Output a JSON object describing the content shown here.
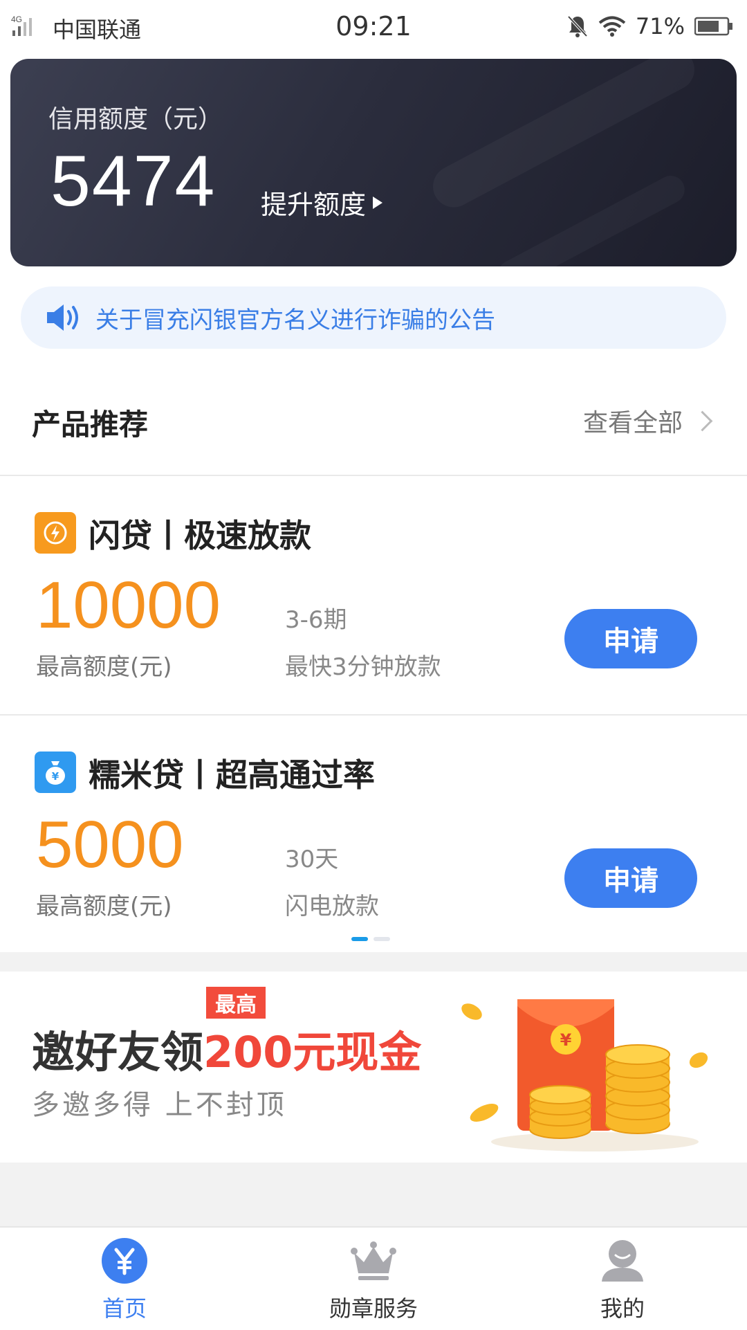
{
  "status_bar": {
    "network": "4G",
    "carrier": "中国联通",
    "time": "09:21",
    "battery": "71%"
  },
  "credit": {
    "label": "信用额度（元）",
    "amount": "5474",
    "raise_label": "提升额度"
  },
  "notice": {
    "text": "关于冒充闪银官方名义进行诈骗的公告"
  },
  "products_section": {
    "title": "产品推荐",
    "see_all": "查看全部"
  },
  "products": [
    {
      "title": "闪贷丨极速放款",
      "amount": "10000",
      "amount_label": "最高额度(元)",
      "term": "3-6期",
      "desc": "最快3分钟放款",
      "apply": "申请",
      "logo_color": "#f79a1e"
    },
    {
      "title": "糯米贷丨超高通过率",
      "amount": "5000",
      "amount_label": "最高额度(元)",
      "term": "30天",
      "desc": "闪电放款",
      "apply": "申请",
      "logo_color": "#2f9af0"
    }
  ],
  "banner": {
    "tag": "最高",
    "title_dark": "邀好友领",
    "title_red": "200元现金",
    "subtitle": "多邀多得  上不封顶"
  },
  "bottom_nav": {
    "home": "首页",
    "medal": "勋章服务",
    "mine": "我的"
  },
  "colors": {
    "accent_blue": "#3d7ff0",
    "amount_orange": "#f5911e",
    "banner_red": "#f0473a"
  }
}
